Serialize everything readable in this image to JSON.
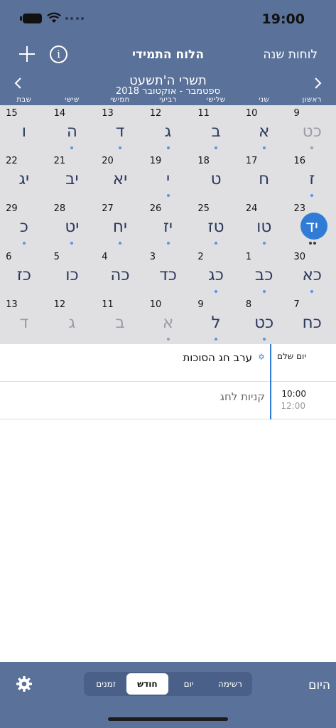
{
  "status": {
    "time": "19:00"
  },
  "nav": {
    "title": "הלוח התמידי",
    "years": "לוחות שנה"
  },
  "month": {
    "hebrew": "תשרי ה'תשעט",
    "gregorian": "ספטמבר - אוקטובר 2018"
  },
  "weekdays": [
    "ראשון",
    "שני",
    "שלישי",
    "רביעי",
    "חמישי",
    "שישי",
    "שבת"
  ],
  "days": [
    {
      "g": "9",
      "h": "כט",
      "muted": true,
      "dot": "grey"
    },
    {
      "g": "10",
      "h": "א",
      "dot": "blue"
    },
    {
      "g": "11",
      "h": "ב",
      "dot": "blue"
    },
    {
      "g": "12",
      "h": "ג",
      "dot": "blue"
    },
    {
      "g": "13",
      "h": "ד",
      "dot": "blue"
    },
    {
      "g": "14",
      "h": "ה",
      "dot": "blue"
    },
    {
      "g": "15",
      "h": "ו"
    },
    {
      "g": "16",
      "h": "ז",
      "dot": "blue"
    },
    {
      "g": "17",
      "h": "ח"
    },
    {
      "g": "18",
      "h": "ט"
    },
    {
      "g": "19",
      "h": "י",
      "dot": "blue"
    },
    {
      "g": "20",
      "h": "יא"
    },
    {
      "g": "21",
      "h": "יב"
    },
    {
      "g": "22",
      "h": "יג"
    },
    {
      "g": "23",
      "h": "יד",
      "today": true,
      "dot": "black"
    },
    {
      "g": "24",
      "h": "טו",
      "dot": "blue"
    },
    {
      "g": "25",
      "h": "טז",
      "dot": "blue"
    },
    {
      "g": "26",
      "h": "יז",
      "dot": "blue"
    },
    {
      "g": "27",
      "h": "יח",
      "dot": "blue"
    },
    {
      "g": "28",
      "h": "יט",
      "dot": "blue"
    },
    {
      "g": "29",
      "h": "כ",
      "dot": "blue"
    },
    {
      "g": "30",
      "h": "כא",
      "dot": "blue"
    },
    {
      "g": "1",
      "h": "כב",
      "dot": "blue"
    },
    {
      "g": "2",
      "h": "כג",
      "dot": "blue"
    },
    {
      "g": "3",
      "h": "כד"
    },
    {
      "g": "4",
      "h": "כה"
    },
    {
      "g": "5",
      "h": "כו"
    },
    {
      "g": "6",
      "h": "כז"
    },
    {
      "g": "7",
      "h": "כח"
    },
    {
      "g": "8",
      "h": "כט",
      "dot": "blue"
    },
    {
      "g": "9",
      "h": "ל",
      "dot": "blue"
    },
    {
      "g": "10",
      "h": "א",
      "muted": true,
      "dot": "grey"
    },
    {
      "g": "11",
      "h": "ב",
      "muted": true
    },
    {
      "g": "12",
      "h": "ג",
      "muted": true
    },
    {
      "g": "13",
      "h": "ד",
      "muted": true
    }
  ],
  "events": [
    {
      "time": "יום שלם",
      "end": "",
      "title": "ערב חג הסוכות",
      "star": true
    },
    {
      "time": "10:00",
      "end": "12:00",
      "title": "קניות לחג",
      "star": false
    }
  ],
  "tabbar": {
    "segments": [
      "רשימה",
      "יום",
      "חודש",
      "זמנים"
    ],
    "active": 2,
    "today_label": "היום"
  },
  "colors": {
    "header": "#5a7199",
    "accent": "#2f7bd6",
    "grid": "#e0e0e3"
  }
}
